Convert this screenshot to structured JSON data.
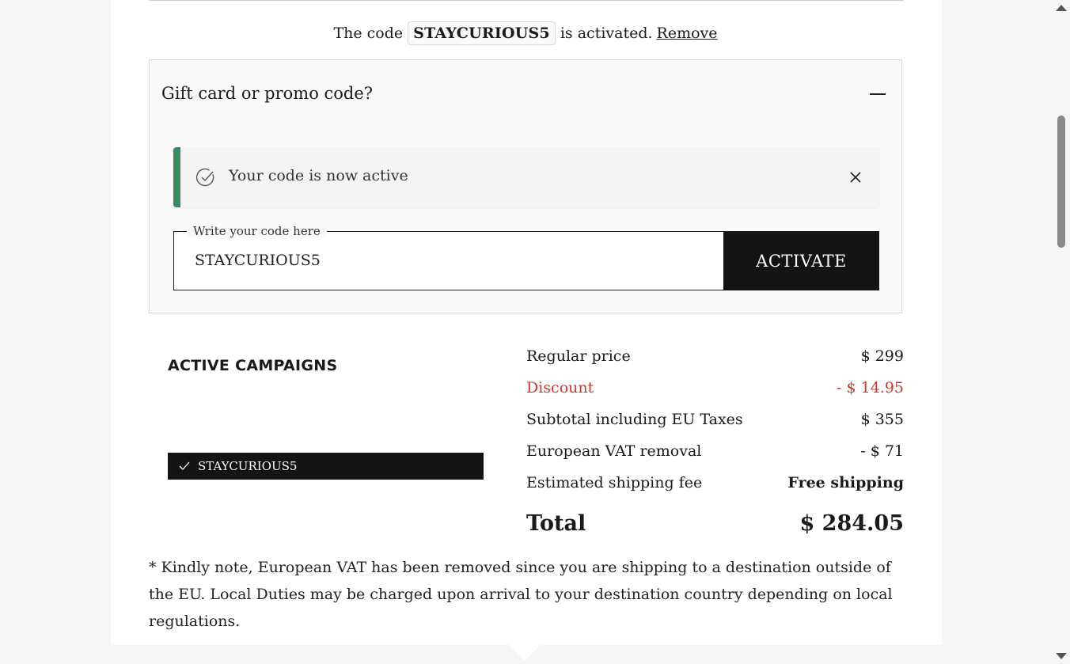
{
  "code_banner": {
    "prefix": "The code",
    "code": "STAYCURIOUS5",
    "suffix": "is activated.",
    "remove_label": "Remove"
  },
  "promo": {
    "title": "Gift card or promo code?",
    "alert_text": "Your code is now active",
    "field_legend": "Write your code here",
    "field_value": "STAYCURIOUS5",
    "activate_label": "ACTIVATE"
  },
  "campaigns": {
    "title": "ACTIVE CAMPAIGNS",
    "tags": [
      {
        "label": "STAYCURIOUS5"
      }
    ]
  },
  "summary": {
    "regular_price_label": "Regular price",
    "regular_price_value": "$ 299",
    "discount_label": "Discount",
    "discount_value": "- $ 14.95",
    "subtotal_label": "Subtotal including EU Taxes",
    "subtotal_value": "$ 355",
    "vat_label": "European VAT removal",
    "vat_value": "- $ 71",
    "shipping_label": "Estimated shipping fee",
    "shipping_value": "Free shipping",
    "total_label": "Total",
    "total_value": "$ 284.05"
  },
  "note": "* Kindly note, European VAT has been removed since you are shipping to a destination outside of the EU. Local Duties may be charged upon arrival to your destination country depending on local regulations.",
  "colors": {
    "accent_green": "#3d8a5f",
    "discount_red": "#d0342c",
    "button_black": "#141414"
  }
}
